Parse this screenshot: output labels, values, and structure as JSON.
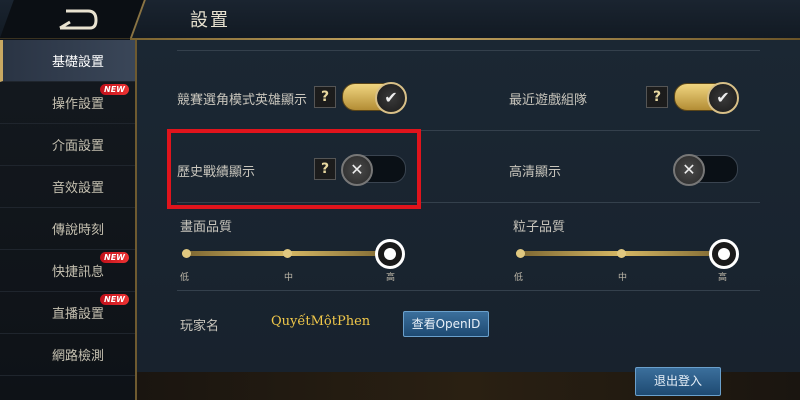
{
  "header": {
    "title": "設置",
    "back_icon": "back-arrow-icon"
  },
  "sidebar": {
    "items": [
      {
        "label": "基礎設置",
        "active": true,
        "badge": ""
      },
      {
        "label": "操作設置",
        "active": false,
        "badge": "NEW"
      },
      {
        "label": "介面設置",
        "active": false,
        "badge": ""
      },
      {
        "label": "音效設置",
        "active": false,
        "badge": ""
      },
      {
        "label": "傳說時刻",
        "active": false,
        "badge": ""
      },
      {
        "label": "快捷訊息",
        "active": false,
        "badge": "NEW"
      },
      {
        "label": "直播設置",
        "active": false,
        "badge": "NEW"
      },
      {
        "label": "網路檢測",
        "active": false,
        "badge": ""
      }
    ]
  },
  "settings": {
    "competitive_hero_display": {
      "label": "競賽選角模式英雄顯示",
      "help": "?",
      "state": "on"
    },
    "recent_team": {
      "label": "最近遊戲組隊",
      "help": "?",
      "state": "on"
    },
    "history_record": {
      "label": "歷史戰績顯示",
      "help": "?",
      "state": "off"
    },
    "hd_display": {
      "label": "高清顯示",
      "state": "off"
    }
  },
  "quality": {
    "graphics": {
      "label": "畫面品質",
      "level": "高",
      "ticks": [
        "低",
        "中",
        "高"
      ]
    },
    "particle": {
      "label": "粒子品質",
      "level": "高",
      "ticks": [
        "低",
        "中",
        "高"
      ]
    }
  },
  "player": {
    "label": "玩家名",
    "name": "QuyếtMộtPhen",
    "openid_button": "查看OpenID"
  },
  "footer": {
    "logout_button": "退出登入"
  },
  "colors": {
    "accent_gold": "#c8a862",
    "highlight_red": "#e0141c",
    "button_blue": "#2f6392"
  }
}
